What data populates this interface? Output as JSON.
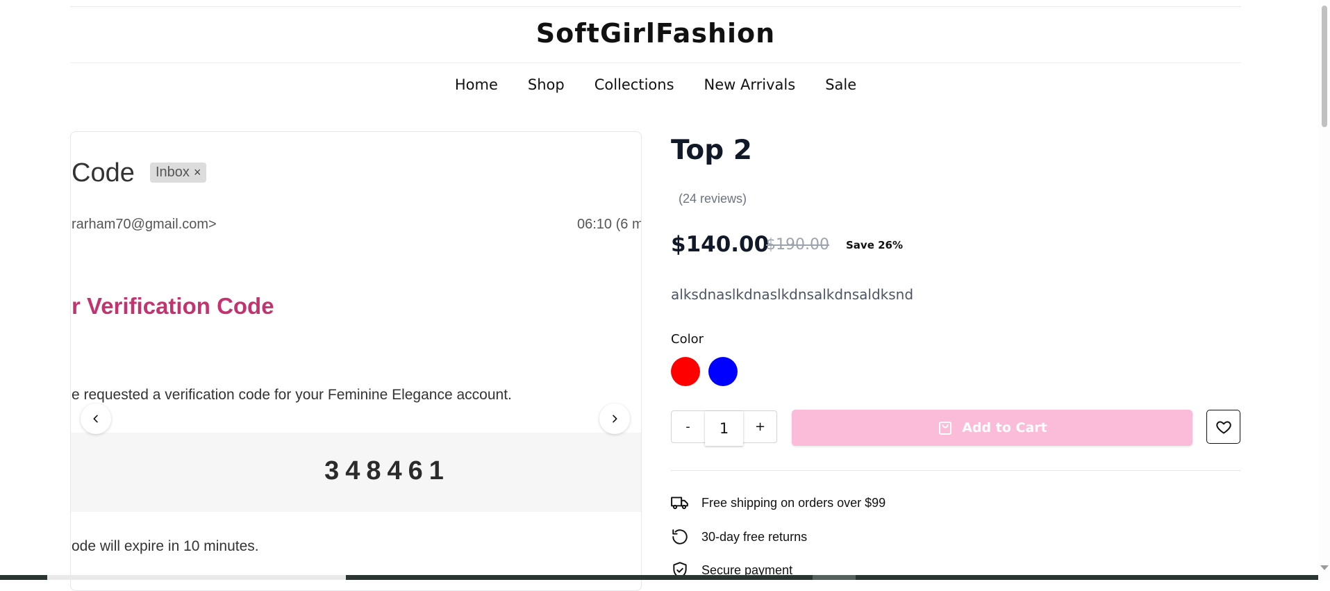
{
  "header": {
    "brand": "SoftGirlFashion"
  },
  "nav": {
    "items": [
      "Home",
      "Shop",
      "Collections",
      "New Arrivals",
      "Sale"
    ]
  },
  "gallery": {
    "image": {
      "subject": "Code",
      "chip": "Inbox",
      "chip_close": "×",
      "sender": "rarham70@gmail.com>",
      "time": "06:10 (6 m",
      "heading": "r Verification Code",
      "line1": "e requested a verification code for your Feminine Elegance account.",
      "code": "348461",
      "expire": "ode will expire in 10 minutes."
    },
    "prev_icon": "chevron-left-icon",
    "next_icon": "chevron-right-icon"
  },
  "product": {
    "title": "Top 2",
    "reviews": "(24 reviews)",
    "price": "$140.00",
    "old_price": "$190.00",
    "save": "Save 26%",
    "description": "alksdnaslkdnaslkdnsalkdnsaldksnd",
    "color_label": "Color",
    "colors": [
      {
        "name": "red",
        "hex": "#ff0000"
      },
      {
        "name": "blue",
        "hex": "#0000ff"
      }
    ],
    "quantity": {
      "minus": "-",
      "value": "1",
      "plus": "+"
    },
    "add_to_cart": "Add to Cart",
    "accent_color": "#fbbcda"
  },
  "features": [
    {
      "icon": "truck-icon",
      "text": "Free shipping on orders over $99"
    },
    {
      "icon": "rotate-ccw-icon",
      "text": "30-day free returns"
    },
    {
      "icon": "shield-check-icon",
      "text": "Secure payment"
    }
  ]
}
